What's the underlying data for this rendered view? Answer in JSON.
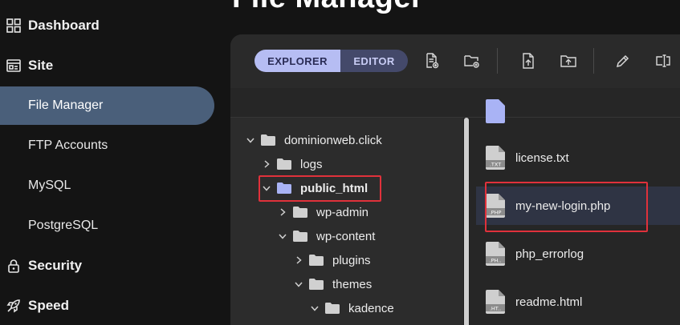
{
  "page": {
    "title": "File Manager"
  },
  "sidebar": {
    "items": [
      {
        "label": "Dashboard",
        "type": "top",
        "icon": "grid-icon"
      },
      {
        "label": "Site",
        "type": "top",
        "icon": "site-icon"
      },
      {
        "label": "File Manager",
        "type": "sub",
        "active": true
      },
      {
        "label": "FTP Accounts",
        "type": "sub"
      },
      {
        "label": "MySQL",
        "type": "sub"
      },
      {
        "label": "PostgreSQL",
        "type": "sub"
      },
      {
        "label": "Security",
        "type": "top",
        "icon": "lock-icon"
      },
      {
        "label": "Speed",
        "type": "top",
        "icon": "rocket-icon"
      }
    ]
  },
  "toolbar": {
    "explorer_label": "EXPLORER",
    "editor_label": "EDITOR",
    "tools": [
      "new-file-icon",
      "new-folder-icon",
      "upload-file-icon",
      "upload-folder-icon",
      "edit-icon",
      "rename-icon"
    ]
  },
  "tree": {
    "items": [
      {
        "label": "dominionweb.click",
        "expanded": true
      },
      {
        "label": "logs",
        "expanded": false
      },
      {
        "label": "public_html",
        "expanded": true,
        "highlighted": true
      },
      {
        "label": "wp-admin",
        "expanded": false
      },
      {
        "label": "wp-content",
        "expanded": true
      },
      {
        "label": "plugins",
        "expanded": false
      },
      {
        "label": "themes",
        "expanded": true
      },
      {
        "label": "kadence",
        "expanded": true
      }
    ]
  },
  "files": {
    "items": [
      {
        "name": "license.txt",
        "ext": ".TXT"
      },
      {
        "name": "my-new-login.php",
        "ext": ".PHP",
        "selected": true
      },
      {
        "name": "php_errorlog",
        "ext": ".PH.."
      },
      {
        "name": "readme.html",
        "ext": ".HT.."
      }
    ]
  },
  "colors": {
    "accent": "#b6bdf3",
    "active_nav": "#4a5f7a",
    "highlight": "#e0313b",
    "folder": "#d0d0d0",
    "folder_active": "#a9b3f5"
  }
}
